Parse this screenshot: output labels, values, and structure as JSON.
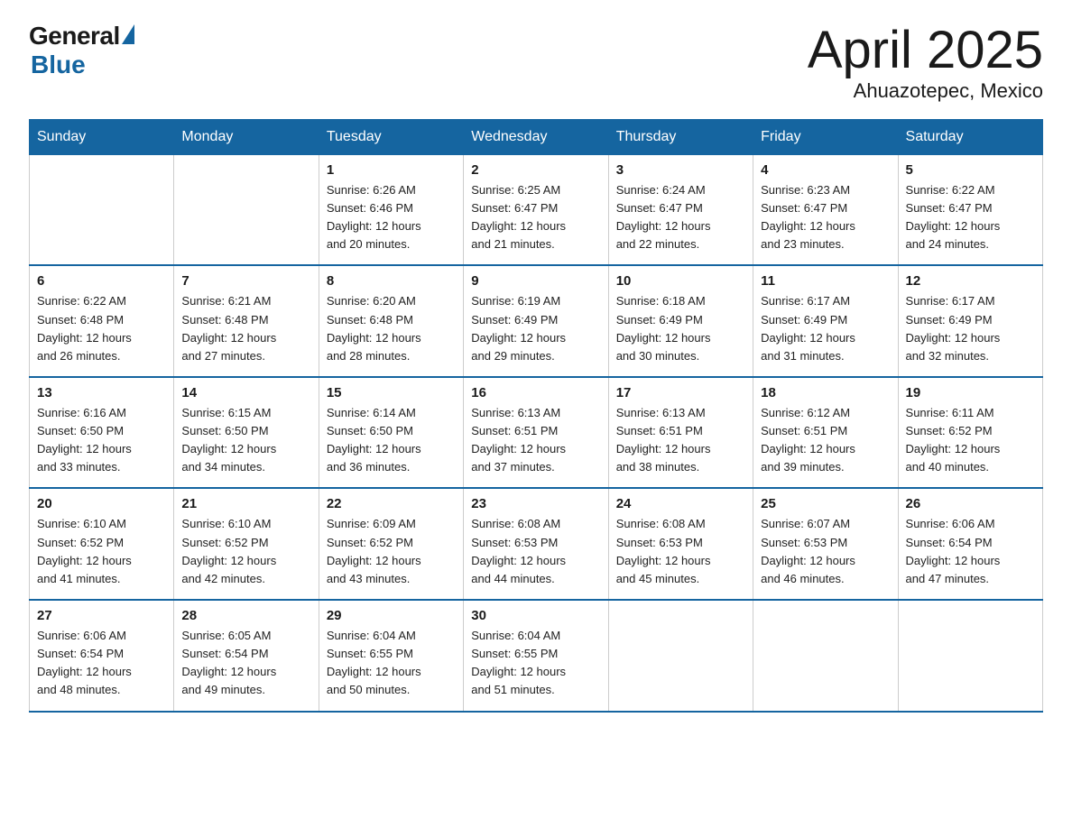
{
  "logo": {
    "general": "General",
    "blue": "Blue"
  },
  "title": {
    "month_year": "April 2025",
    "location": "Ahuazotepec, Mexico"
  },
  "weekdays": [
    "Sunday",
    "Monday",
    "Tuesday",
    "Wednesday",
    "Thursday",
    "Friday",
    "Saturday"
  ],
  "weeks": [
    [
      {
        "day": "",
        "info": ""
      },
      {
        "day": "",
        "info": ""
      },
      {
        "day": "1",
        "info": "Sunrise: 6:26 AM\nSunset: 6:46 PM\nDaylight: 12 hours\nand 20 minutes."
      },
      {
        "day": "2",
        "info": "Sunrise: 6:25 AM\nSunset: 6:47 PM\nDaylight: 12 hours\nand 21 minutes."
      },
      {
        "day": "3",
        "info": "Sunrise: 6:24 AM\nSunset: 6:47 PM\nDaylight: 12 hours\nand 22 minutes."
      },
      {
        "day": "4",
        "info": "Sunrise: 6:23 AM\nSunset: 6:47 PM\nDaylight: 12 hours\nand 23 minutes."
      },
      {
        "day": "5",
        "info": "Sunrise: 6:22 AM\nSunset: 6:47 PM\nDaylight: 12 hours\nand 24 minutes."
      }
    ],
    [
      {
        "day": "6",
        "info": "Sunrise: 6:22 AM\nSunset: 6:48 PM\nDaylight: 12 hours\nand 26 minutes."
      },
      {
        "day": "7",
        "info": "Sunrise: 6:21 AM\nSunset: 6:48 PM\nDaylight: 12 hours\nand 27 minutes."
      },
      {
        "day": "8",
        "info": "Sunrise: 6:20 AM\nSunset: 6:48 PM\nDaylight: 12 hours\nand 28 minutes."
      },
      {
        "day": "9",
        "info": "Sunrise: 6:19 AM\nSunset: 6:49 PM\nDaylight: 12 hours\nand 29 minutes."
      },
      {
        "day": "10",
        "info": "Sunrise: 6:18 AM\nSunset: 6:49 PM\nDaylight: 12 hours\nand 30 minutes."
      },
      {
        "day": "11",
        "info": "Sunrise: 6:17 AM\nSunset: 6:49 PM\nDaylight: 12 hours\nand 31 minutes."
      },
      {
        "day": "12",
        "info": "Sunrise: 6:17 AM\nSunset: 6:49 PM\nDaylight: 12 hours\nand 32 minutes."
      }
    ],
    [
      {
        "day": "13",
        "info": "Sunrise: 6:16 AM\nSunset: 6:50 PM\nDaylight: 12 hours\nand 33 minutes."
      },
      {
        "day": "14",
        "info": "Sunrise: 6:15 AM\nSunset: 6:50 PM\nDaylight: 12 hours\nand 34 minutes."
      },
      {
        "day": "15",
        "info": "Sunrise: 6:14 AM\nSunset: 6:50 PM\nDaylight: 12 hours\nand 36 minutes."
      },
      {
        "day": "16",
        "info": "Sunrise: 6:13 AM\nSunset: 6:51 PM\nDaylight: 12 hours\nand 37 minutes."
      },
      {
        "day": "17",
        "info": "Sunrise: 6:13 AM\nSunset: 6:51 PM\nDaylight: 12 hours\nand 38 minutes."
      },
      {
        "day": "18",
        "info": "Sunrise: 6:12 AM\nSunset: 6:51 PM\nDaylight: 12 hours\nand 39 minutes."
      },
      {
        "day": "19",
        "info": "Sunrise: 6:11 AM\nSunset: 6:52 PM\nDaylight: 12 hours\nand 40 minutes."
      }
    ],
    [
      {
        "day": "20",
        "info": "Sunrise: 6:10 AM\nSunset: 6:52 PM\nDaylight: 12 hours\nand 41 minutes."
      },
      {
        "day": "21",
        "info": "Sunrise: 6:10 AM\nSunset: 6:52 PM\nDaylight: 12 hours\nand 42 minutes."
      },
      {
        "day": "22",
        "info": "Sunrise: 6:09 AM\nSunset: 6:52 PM\nDaylight: 12 hours\nand 43 minutes."
      },
      {
        "day": "23",
        "info": "Sunrise: 6:08 AM\nSunset: 6:53 PM\nDaylight: 12 hours\nand 44 minutes."
      },
      {
        "day": "24",
        "info": "Sunrise: 6:08 AM\nSunset: 6:53 PM\nDaylight: 12 hours\nand 45 minutes."
      },
      {
        "day": "25",
        "info": "Sunrise: 6:07 AM\nSunset: 6:53 PM\nDaylight: 12 hours\nand 46 minutes."
      },
      {
        "day": "26",
        "info": "Sunrise: 6:06 AM\nSunset: 6:54 PM\nDaylight: 12 hours\nand 47 minutes."
      }
    ],
    [
      {
        "day": "27",
        "info": "Sunrise: 6:06 AM\nSunset: 6:54 PM\nDaylight: 12 hours\nand 48 minutes."
      },
      {
        "day": "28",
        "info": "Sunrise: 6:05 AM\nSunset: 6:54 PM\nDaylight: 12 hours\nand 49 minutes."
      },
      {
        "day": "29",
        "info": "Sunrise: 6:04 AM\nSunset: 6:55 PM\nDaylight: 12 hours\nand 50 minutes."
      },
      {
        "day": "30",
        "info": "Sunrise: 6:04 AM\nSunset: 6:55 PM\nDaylight: 12 hours\nand 51 minutes."
      },
      {
        "day": "",
        "info": ""
      },
      {
        "day": "",
        "info": ""
      },
      {
        "day": "",
        "info": ""
      }
    ]
  ]
}
